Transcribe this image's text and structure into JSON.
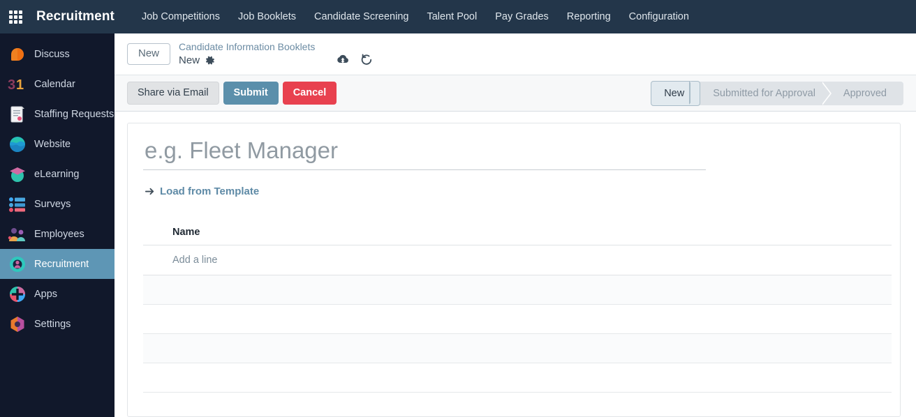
{
  "navbar": {
    "apps_icon": "grid-apps-icon",
    "brand": "Recruitment",
    "menu": [
      {
        "label": "Job Competitions"
      },
      {
        "label": "Job Booklets"
      },
      {
        "label": "Candidate Screening"
      },
      {
        "label": "Talent Pool"
      },
      {
        "label": "Pay Grades"
      },
      {
        "label": "Reporting"
      },
      {
        "label": "Configuration"
      }
    ]
  },
  "sidebar": {
    "items": [
      {
        "label": "Discuss",
        "icon": "discuss-icon",
        "active": false
      },
      {
        "label": "Calendar",
        "icon": "calendar-icon",
        "active": false
      },
      {
        "label": "Staffing Requests",
        "icon": "staffing-requests-icon",
        "active": false
      },
      {
        "label": "Website",
        "icon": "website-icon",
        "active": false
      },
      {
        "label": "eLearning",
        "icon": "elearning-icon",
        "active": false
      },
      {
        "label": "Surveys",
        "icon": "surveys-icon",
        "active": false
      },
      {
        "label": "Employees",
        "icon": "employees-icon",
        "active": false
      },
      {
        "label": "Recruitment",
        "icon": "recruitment-icon",
        "active": true
      },
      {
        "label": "Apps",
        "icon": "apps-icon",
        "active": false
      },
      {
        "label": "Settings",
        "icon": "settings-icon",
        "active": false
      }
    ]
  },
  "breadcrumb": {
    "new_button": "New",
    "parent": "Candidate Information Booklets",
    "current": "New",
    "gear_icon": "gear-icon",
    "save_icon": "cloud-upload-icon",
    "discard_icon": "undo-discard-icon"
  },
  "control_bar": {
    "buttons": [
      {
        "label": "Share via Email",
        "style": "share"
      },
      {
        "label": "Submit",
        "style": "submit"
      },
      {
        "label": "Cancel",
        "style": "cancel"
      }
    ],
    "statusbar": {
      "steps": [
        {
          "label": "New",
          "active": true
        },
        {
          "label": "Submitted for Approval",
          "active": false
        },
        {
          "label": "Approved",
          "active": false
        }
      ]
    }
  },
  "form": {
    "title_placeholder": "e.g. Fleet Manager",
    "title_value": "",
    "template_link": {
      "label": "Load from Template",
      "icon": "arrow-right-icon"
    },
    "lines_table": {
      "columns": [
        "Name"
      ],
      "add_line_label": "Add a line",
      "rows": [],
      "empty_row_count": 4
    }
  },
  "colors": {
    "navbar_bg": "#23364a",
    "sidebar_bg": "#11182b",
    "sidebar_active_bg": "#5e96b5",
    "submit_blue": "#5b8fab",
    "cancel_red": "#e8414f",
    "share_grey": "#e1e3e5",
    "link_blue": "#5e8aa6",
    "control_bar_bg": "#f7f8f9"
  }
}
